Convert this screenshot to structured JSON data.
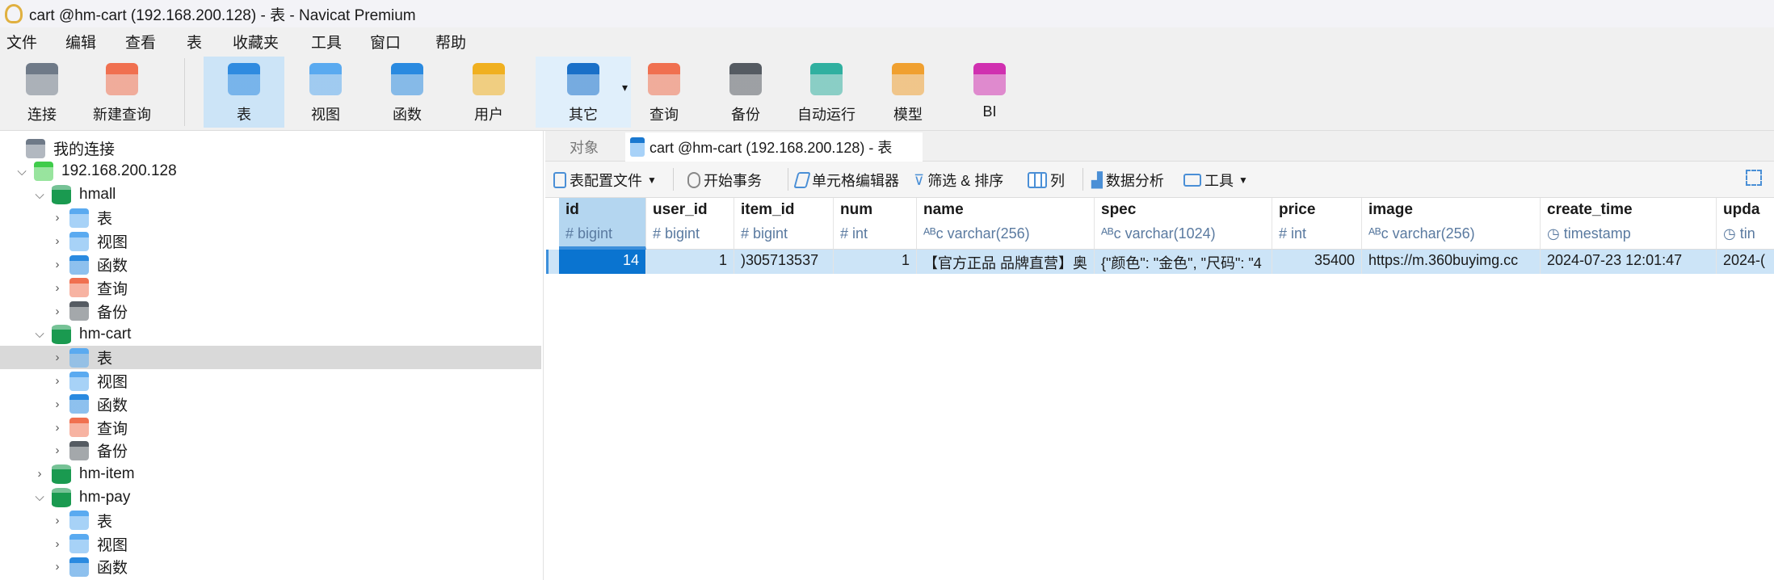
{
  "window": {
    "title": "cart @hm-cart (192.168.200.128) - 表 - Navicat Premium"
  },
  "menu": [
    "文件",
    "编辑",
    "查看",
    "表",
    "收藏夹",
    "工具",
    "窗口",
    "帮助"
  ],
  "toolbar": [
    {
      "label": "连接",
      "icon": "connection-plug-icon",
      "color": "#6f7a88"
    },
    {
      "label": "新建查询",
      "icon": "new-query-icon",
      "color": "#f07050"
    },
    {
      "label": "表",
      "icon": "table-icon",
      "color": "#2f8be0",
      "selected": true
    },
    {
      "label": "视图",
      "icon": "view-icon",
      "color": "#5aaaf0"
    },
    {
      "label": "函数",
      "icon": "function-icon",
      "color": "#2a8ae0"
    },
    {
      "label": "用户",
      "icon": "user-icon",
      "color": "#f0b020"
    },
    {
      "label": "其它",
      "icon": "tools-icon",
      "color": "#1a70c8",
      "dropdown": true
    },
    {
      "label": "查询",
      "icon": "query-icon",
      "color": "#f07050"
    },
    {
      "label": "备份",
      "icon": "backup-icon",
      "color": "#555b62"
    },
    {
      "label": "自动运行",
      "icon": "robot-icon",
      "color": "#30b0a0"
    },
    {
      "label": "模型",
      "icon": "model-icon",
      "color": "#f0a030"
    },
    {
      "label": "BI",
      "icon": "bi-icon",
      "color": "#d030b0"
    }
  ],
  "tree": [
    {
      "label": "我的连接",
      "level": 0,
      "icon": "connection-plug-icon",
      "color": "#6f7a88",
      "chev": ""
    },
    {
      "label": "192.168.200.128",
      "level": 1,
      "icon": "mysql-server-icon",
      "color": "#3fcc4a",
      "chev": "⌄"
    },
    {
      "label": "hmall",
      "level": 2,
      "icon": "database-icon",
      "color": "#1a9a50",
      "chev": "⌄"
    },
    {
      "label": "表",
      "level": 3,
      "icon": "table-icon",
      "color": "#5aaaf0",
      "chev": "›"
    },
    {
      "label": "视图",
      "level": 3,
      "icon": "view-icon",
      "color": "#5aaaf0",
      "chev": "›"
    },
    {
      "label": "函数",
      "level": 3,
      "icon": "function-icon",
      "color": "#2a8ae0",
      "chev": "›"
    },
    {
      "label": "查询",
      "level": 3,
      "icon": "query-icon",
      "color": "#f07050",
      "chev": "›"
    },
    {
      "label": "备份",
      "level": 3,
      "icon": "backup-icon",
      "color": "#555b62",
      "chev": "›"
    },
    {
      "label": "hm-cart",
      "level": 2,
      "icon": "database-icon",
      "color": "#1a9a50",
      "chev": "⌄"
    },
    {
      "label": "表",
      "level": 3,
      "icon": "table-icon",
      "color": "#5aaaf0",
      "chev": "›",
      "selected": true
    },
    {
      "label": "视图",
      "level": 3,
      "icon": "view-icon",
      "color": "#5aaaf0",
      "chev": "›"
    },
    {
      "label": "函数",
      "level": 3,
      "icon": "function-icon",
      "color": "#2a8ae0",
      "chev": "›"
    },
    {
      "label": "查询",
      "level": 3,
      "icon": "query-icon",
      "color": "#f07050",
      "chev": "›"
    },
    {
      "label": "备份",
      "level": 3,
      "icon": "backup-icon",
      "color": "#555b62",
      "chev": "›"
    },
    {
      "label": "hm-item",
      "level": 2,
      "icon": "database-icon",
      "color": "#1a9a50",
      "chev": "›"
    },
    {
      "label": "hm-pay",
      "level": 2,
      "icon": "database-icon",
      "color": "#1a9a50",
      "chev": "⌄"
    },
    {
      "label": "表",
      "level": 3,
      "icon": "table-icon",
      "color": "#5aaaf0",
      "chev": "›"
    },
    {
      "label": "视图",
      "level": 3,
      "icon": "view-icon",
      "color": "#5aaaf0",
      "chev": "›"
    },
    {
      "label": "函数",
      "level": 3,
      "icon": "function-icon",
      "color": "#2a8ae0",
      "chev": "›"
    }
  ],
  "tabs": {
    "objects": "对象",
    "active": "cart @hm-cart (192.168.200.128) - 表"
  },
  "subtoolbar": {
    "profile": "表配置文件",
    "begin_tx": "开始事务",
    "cell_editor": "单元格编辑器",
    "filter_sort": "筛选 & 排序",
    "columns": "列",
    "analysis": "数据分析",
    "tools": "工具"
  },
  "columns": [
    {
      "name": "id",
      "type": "# bigint"
    },
    {
      "name": "user_id",
      "type": "# bigint"
    },
    {
      "name": "item_id",
      "type": "# bigint"
    },
    {
      "name": "num",
      "type": "# int"
    },
    {
      "name": "name",
      "type": "ᴬᴮc varchar(256)"
    },
    {
      "name": "spec",
      "type": "ᴬᴮc varchar(1024)"
    },
    {
      "name": "price",
      "type": "# int"
    },
    {
      "name": "image",
      "type": "ᴬᴮc varchar(256)"
    },
    {
      "name": "create_time",
      "type": "◷ timestamp"
    },
    {
      "name": "upda",
      "type": "◷ tin"
    }
  ],
  "rows": [
    [
      "14",
      "1",
      ")305713537",
      "1",
      "【官方正品 品牌直营】奥",
      "{\"颜色\": \"金色\", \"尺码\": \"4",
      "35400",
      "https://m.360buyimg.cc",
      "2024-07-23 12:01:47",
      "2024-("
    ]
  ]
}
